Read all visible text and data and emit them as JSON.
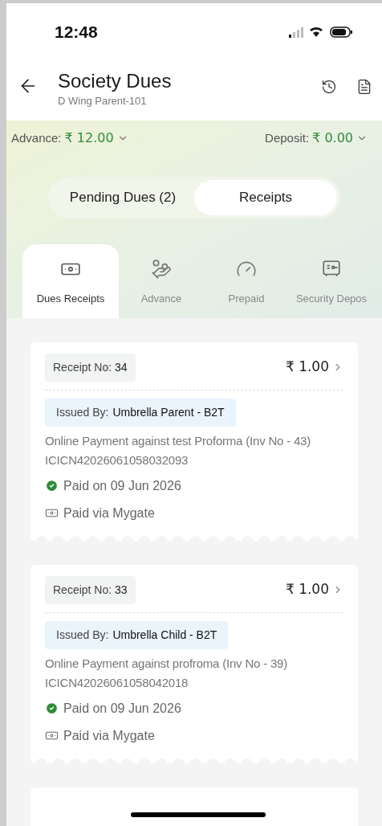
{
  "status_bar": {
    "time": "12:48"
  },
  "header": {
    "title": "Society Dues",
    "subtitle": "D Wing Parent-101"
  },
  "balances": [
    {
      "label": "Advance:",
      "amount": "₹ 12.00"
    },
    {
      "label": "Deposit:",
      "amount": "₹ 0.00"
    }
  ],
  "segments": [
    {
      "label": "Pending Dues (2)",
      "selected": false
    },
    {
      "label": "Receipts",
      "selected": true
    }
  ],
  "tabs": [
    {
      "label": "Dues Receipts",
      "selected": true
    },
    {
      "label": "Advance",
      "selected": false
    },
    {
      "label": "Prepaid",
      "selected": false
    },
    {
      "label": "Security Depos",
      "selected": false
    }
  ],
  "receipts": [
    {
      "receipt_label": "Receipt No:",
      "receipt_no": "34",
      "amount": "₹ 1.00",
      "issued_label": "Issued By:",
      "issued_by": "Umbrella Parent - B2T",
      "description": "Online Payment against test Proforma (Inv No - 43) ICICN42026061058032093",
      "paid_on": "Paid on 09 Jun 2026",
      "paid_via": "Paid via Mygate"
    },
    {
      "receipt_label": "Receipt No:",
      "receipt_no": "33",
      "amount": "₹ 1.00",
      "issued_label": "Issued By:",
      "issued_by": "Umbrella Child - B2T",
      "description": "Online Payment against profroma (Inv No - 39) ICICN42026061058042018",
      "paid_on": "Paid on 09 Jun 2026",
      "paid_via": "Paid via Mygate"
    }
  ]
}
